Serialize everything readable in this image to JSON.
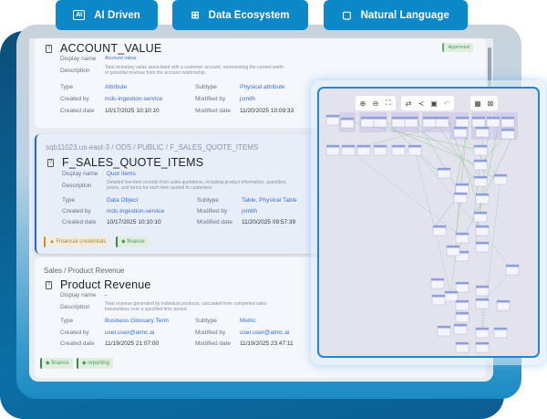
{
  "top_buttons": [
    {
      "label": "AI Driven",
      "icon": "ai-icon"
    },
    {
      "label": "Data Ecosystem",
      "icon": "hierarchy-icon"
    },
    {
      "label": "Natural Language",
      "icon": "chat-icon"
    }
  ],
  "cards": [
    {
      "title": "ACCOUNT_VALUE",
      "badge": "Approved",
      "display_name_label": "Display name",
      "display_name": "Account value",
      "description_label": "Description",
      "description": "Total monetary value associated with a customer account, representing the current worth or potential revenue from the account relationship.",
      "type_label": "Type",
      "type": "Attribute",
      "subtype_label": "Subtype",
      "subtype": "Physical attribute",
      "created_by_label": "Created by",
      "created_by": "mdc-ingestion-service",
      "modified_by_label": "Modified by",
      "modified_by": "jsmith",
      "created_date_label": "Created date",
      "created_date": "10/17/2025 10:10:10",
      "modified_date_label": "Modified date",
      "modified_date": "11/20/2025 10:09:33"
    },
    {
      "breadcrumb": "sqb11023.us-east-3 / ODS / PUBLIC / F_SALES_QUOTE_ITEMS",
      "title": "F_SALES_QUOTE_ITEMS",
      "display_name_label": "Display name",
      "display_name": "Quot Items",
      "description_label": "Description",
      "description": "Detailed line-item records from sales quotations, including product information, quantities, prices, and terms for each item quoted to customers.",
      "type_label": "Type",
      "type": "Data Object",
      "subtype_label": "Subtype",
      "subtype": "Table,  Physical Table",
      "created_by_label": "Created by",
      "created_by": "mdc-ingestion-service",
      "modified_by_label": "Modified by",
      "modified_by": "jsmith",
      "created_date_label": "Created date",
      "created_date": "10/17/2025 10:10:10",
      "modified_date_label": "Modified date",
      "modified_date": "11/20/2025 09:57:39",
      "tags": [
        "Financial credentials",
        "finance"
      ]
    },
    {
      "breadcrumb": "Sales  /  Product Revenue",
      "title": "Product Revenue",
      "display_name_label": "Display name",
      "display_name": "-",
      "description_label": "Description",
      "description": "Total revenue generated by individual products, calculated from completed sales transactions over a specified time period.",
      "type_label": "Type",
      "type": "Business Glossary Term",
      "subtype_label": "Subtype",
      "subtype": "Metric",
      "created_by_label": "Created by",
      "created_by": "user.user@atmc.ai",
      "modified_by_label": "Modified by",
      "modified_by": "user.user@atmc.ai",
      "created_date_label": "Created date",
      "created_date": "11/19/2025 21:07:00",
      "modified_date_label": "Modified date",
      "modified_date": "11/19/2025 23:47:11",
      "tags": [
        "finance",
        "reporting"
      ]
    }
  ],
  "graph": {
    "toolbar": [
      "zoom-in-icon",
      "zoom-out-icon",
      "fit-icon",
      "swap-icon",
      "share-icon",
      "export-icon",
      "undo-icon",
      "grid-icon",
      "minimap-icon"
    ]
  },
  "colors": {
    "accent": "#0a88c8",
    "link": "#3b6fd0",
    "graph_border": "#1e88d8"
  }
}
